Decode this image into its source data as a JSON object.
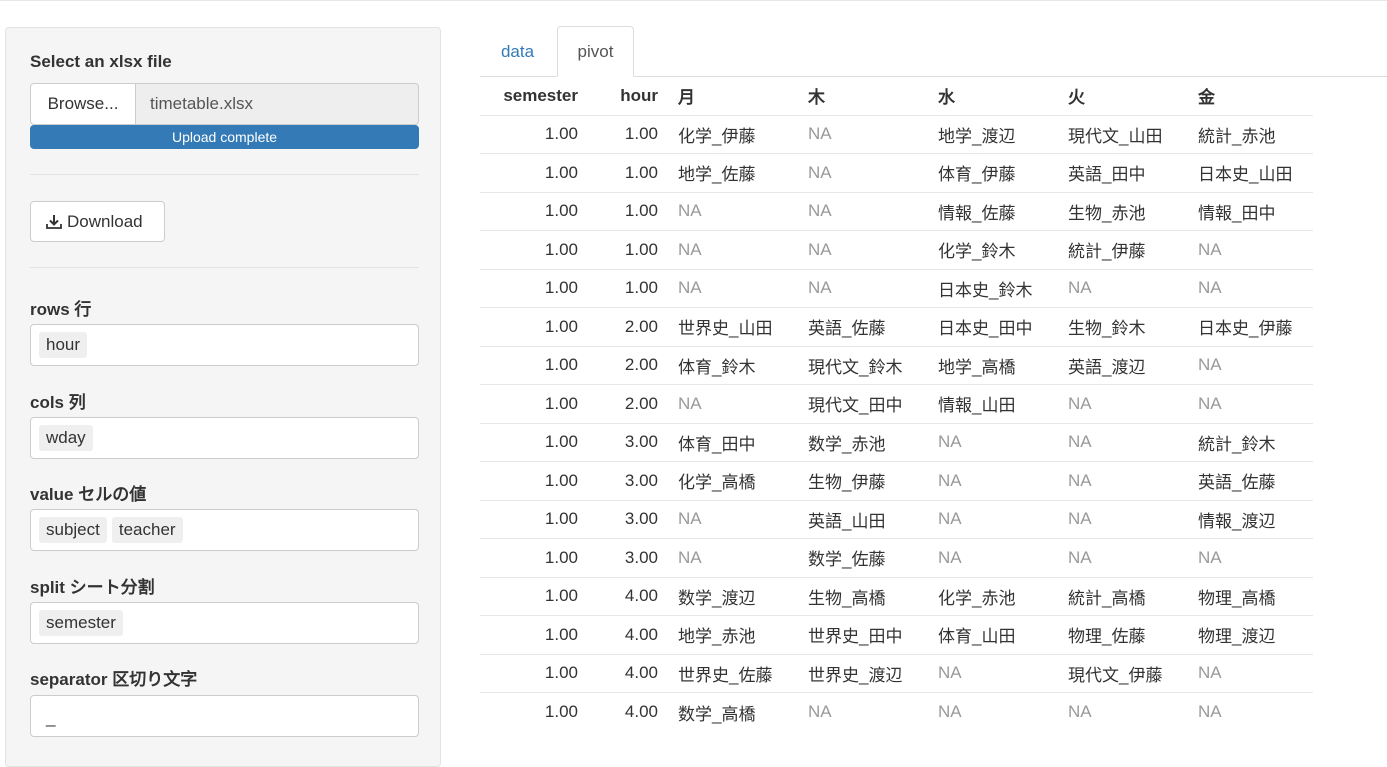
{
  "sidebar": {
    "file_label": "Select an xlsx file",
    "browse_label": "Browse...",
    "file_name": "timetable.xlsx",
    "progress_text": "Upload complete",
    "progress_fraction": 1.0,
    "download_label": "Download",
    "rows_label": "rows 行",
    "rows_values": [
      "hour"
    ],
    "cols_label": "cols 列",
    "cols_values": [
      "wday"
    ],
    "value_label": "value セルの値",
    "value_values": [
      "subject",
      "teacher"
    ],
    "split_label": "split シート分割",
    "split_values": [
      "semester"
    ],
    "separator_label": "separator 区切り文字",
    "separator_value": "_"
  },
  "tabs": [
    {
      "label": "data",
      "active": false
    },
    {
      "label": "pivot",
      "active": true
    }
  ],
  "table": {
    "headers": [
      "semester",
      "hour",
      "月",
      "木",
      "水",
      "火",
      "金"
    ],
    "rows": [
      [
        "1.00",
        "1.00",
        "化学_伊藤",
        "NA",
        "地学_渡辺",
        "現代文_山田",
        "統計_赤池"
      ],
      [
        "1.00",
        "1.00",
        "地学_佐藤",
        "NA",
        "体育_伊藤",
        "英語_田中",
        "日本史_山田"
      ],
      [
        "1.00",
        "1.00",
        "NA",
        "NA",
        "情報_佐藤",
        "生物_赤池",
        "情報_田中"
      ],
      [
        "1.00",
        "1.00",
        "NA",
        "NA",
        "化学_鈴木",
        "統計_伊藤",
        "NA"
      ],
      [
        "1.00",
        "1.00",
        "NA",
        "NA",
        "日本史_鈴木",
        "NA",
        "NA"
      ],
      [
        "1.00",
        "2.00",
        "世界史_山田",
        "英語_佐藤",
        "日本史_田中",
        "生物_鈴木",
        "日本史_伊藤"
      ],
      [
        "1.00",
        "2.00",
        "体育_鈴木",
        "現代文_鈴木",
        "地学_高橋",
        "英語_渡辺",
        "NA"
      ],
      [
        "1.00",
        "2.00",
        "NA",
        "現代文_田中",
        "情報_山田",
        "NA",
        "NA"
      ],
      [
        "1.00",
        "3.00",
        "体育_田中",
        "数学_赤池",
        "NA",
        "NA",
        "統計_鈴木"
      ],
      [
        "1.00",
        "3.00",
        "化学_高橋",
        "生物_伊藤",
        "NA",
        "NA",
        "英語_佐藤"
      ],
      [
        "1.00",
        "3.00",
        "NA",
        "英語_山田",
        "NA",
        "NA",
        "情報_渡辺"
      ],
      [
        "1.00",
        "3.00",
        "NA",
        "数学_佐藤",
        "NA",
        "NA",
        "NA"
      ],
      [
        "1.00",
        "4.00",
        "数学_渡辺",
        "生物_高橋",
        "化学_赤池",
        "統計_高橋",
        "物理_高橋"
      ],
      [
        "1.00",
        "4.00",
        "地学_赤池",
        "世界史_田中",
        "体育_山田",
        "物理_佐藤",
        "物理_渡辺"
      ],
      [
        "1.00",
        "4.00",
        "世界史_佐藤",
        "世界史_渡辺",
        "NA",
        "現代文_伊藤",
        "NA"
      ],
      [
        "1.00",
        "4.00",
        "数学_高橋",
        "NA",
        "NA",
        "NA",
        "NA"
      ]
    ]
  },
  "colors": {
    "accent": "#337ab7",
    "na_text": "#999999",
    "sidebar_bg": "#f5f5f5"
  }
}
